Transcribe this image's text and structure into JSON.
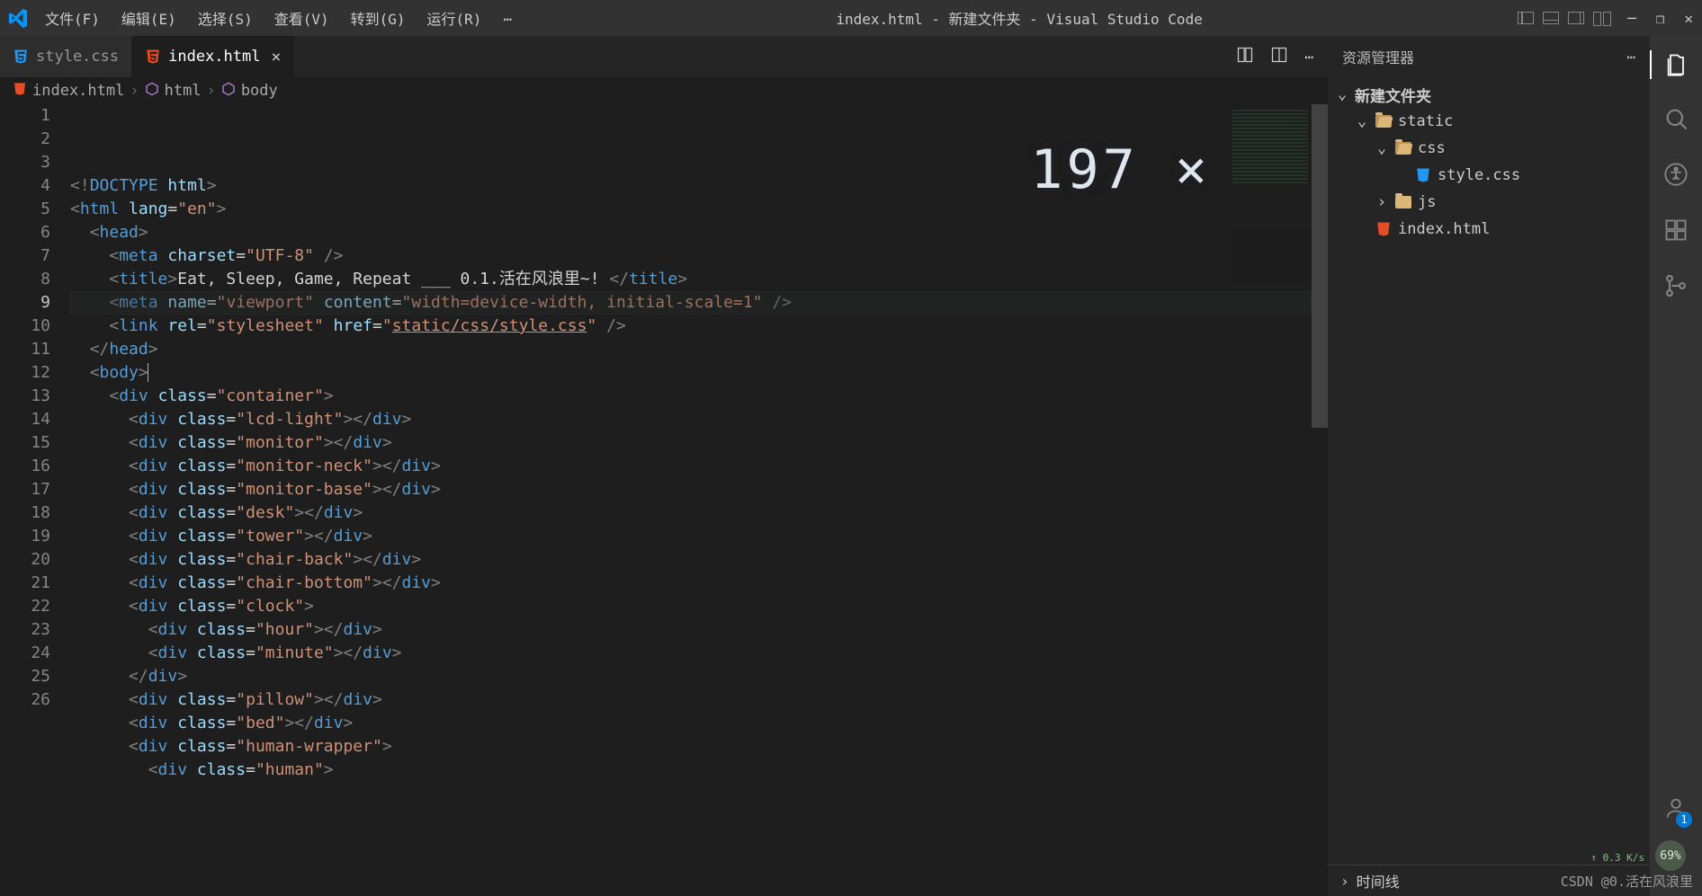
{
  "title": "index.html - 新建文件夹 - Visual Studio Code",
  "menus": [
    "文件(F)",
    "编辑(E)",
    "选择(S)",
    "查看(V)",
    "转到(G)",
    "运行(R)"
  ],
  "menu_more": "…",
  "tabs": [
    {
      "label": "style.css",
      "active": false
    },
    {
      "label": "index.html",
      "active": true
    }
  ],
  "breadcrumb": [
    "index.html",
    "html",
    "body"
  ],
  "overlay_text": "197 ×",
  "explorer": {
    "title": "资源管理器",
    "root": "新建文件夹",
    "tree": [
      {
        "indent": 1,
        "type": "fold-open",
        "label": "static",
        "chev": "v"
      },
      {
        "indent": 2,
        "type": "fold-open",
        "label": "css",
        "chev": "v"
      },
      {
        "indent": 3,
        "type": "css",
        "label": "style.css",
        "chev": ""
      },
      {
        "indent": 2,
        "type": "fold",
        "label": "js",
        "chev": ">"
      },
      {
        "indent": 1,
        "type": "html",
        "label": "index.html",
        "chev": ""
      }
    ],
    "timeline": "时间线"
  },
  "code_lines": [
    {
      "n": 1,
      "html": "<span class='t-bracket'>&lt;!</span><span class='t-tag'>DOCTYPE</span> <span class='t-attr'>html</span><span class='t-bracket'>&gt;</span>"
    },
    {
      "n": 2,
      "html": "<span class='t-bracket'>&lt;</span><span class='t-tag'>html</span> <span class='t-attr'>lang</span>=<span class='t-str'>\"en\"</span><span class='t-bracket'>&gt;</span>"
    },
    {
      "n": 3,
      "html": "  <span class='t-bracket'>&lt;</span><span class='t-tag'>head</span><span class='t-bracket'>&gt;</span>"
    },
    {
      "n": 4,
      "html": "    <span class='t-bracket'>&lt;</span><span class='t-tag'>meta</span> <span class='t-attr'>charset</span>=<span class='t-str'>\"UTF-8\"</span> <span class='t-bracket'>/&gt;</span>"
    },
    {
      "n": 5,
      "html": "    <span class='t-bracket'>&lt;</span><span class='t-tag'>title</span><span class='t-bracket'>&gt;</span>Eat, Sleep, Game, Repeat ___ 0.1.活在风浪里~! <span class='t-bracket'>&lt;/</span><span class='t-tag'>title</span><span class='t-bracket'>&gt;</span>"
    },
    {
      "n": 6,
      "html": "    <span class='t-bracket'>&lt;</span><span class='t-tag'>meta</span> <span class='t-attr'>name</span>=<span class='t-str'>\"viewport\"</span> <span class='t-attr'>content</span>=<span class='t-str'>\"width=device-width, initial-scale=1\"</span> <span class='t-bracket'>/&gt;</span>"
    },
    {
      "n": 7,
      "html": "    <span class='t-bracket'>&lt;</span><span class='t-tag'>link</span> <span class='t-attr'>rel</span>=<span class='t-str'>\"stylesheet\"</span> <span class='t-attr'>href</span>=<span class='t-str'>\"<span class='t-ul'>static/css/style.css</span>\"</span> <span class='t-bracket'>/&gt;</span>"
    },
    {
      "n": 8,
      "html": "  <span class='t-bracket'>&lt;/</span><span class='t-tag'>head</span><span class='t-bracket'>&gt;</span>"
    },
    {
      "n": 9,
      "html": "  <span class='t-bracket'>&lt;</span><span class='t-tag'>body</span><span class='t-bracket'>&gt;</span><span class='cursor'></span>"
    },
    {
      "n": 10,
      "html": "    <span class='t-bracket'>&lt;</span><span class='t-tag'>div</span> <span class='t-attr'>class</span>=<span class='t-str'>\"container\"</span><span class='t-bracket'>&gt;</span>"
    },
    {
      "n": 11,
      "html": "      <span class='t-bracket'>&lt;</span><span class='t-tag'>div</span> <span class='t-attr'>class</span>=<span class='t-str'>\"lcd-light\"</span><span class='t-bracket'>&gt;&lt;/</span><span class='t-tag'>div</span><span class='t-bracket'>&gt;</span>"
    },
    {
      "n": 12,
      "html": "      <span class='t-bracket'>&lt;</span><span class='t-tag'>div</span> <span class='t-attr'>class</span>=<span class='t-str'>\"monitor\"</span><span class='t-bracket'>&gt;&lt;/</span><span class='t-tag'>div</span><span class='t-bracket'>&gt;</span>"
    },
    {
      "n": 13,
      "html": "      <span class='t-bracket'>&lt;</span><span class='t-tag'>div</span> <span class='t-attr'>class</span>=<span class='t-str'>\"monitor-neck\"</span><span class='t-bracket'>&gt;&lt;/</span><span class='t-tag'>div</span><span class='t-bracket'>&gt;</span>"
    },
    {
      "n": 14,
      "html": "      <span class='t-bracket'>&lt;</span><span class='t-tag'>div</span> <span class='t-attr'>class</span>=<span class='t-str'>\"monitor-base\"</span><span class='t-bracket'>&gt;&lt;/</span><span class='t-tag'>div</span><span class='t-bracket'>&gt;</span>"
    },
    {
      "n": 15,
      "html": "      <span class='t-bracket'>&lt;</span><span class='t-tag'>div</span> <span class='t-attr'>class</span>=<span class='t-str'>\"desk\"</span><span class='t-bracket'>&gt;&lt;/</span><span class='t-tag'>div</span><span class='t-bracket'>&gt;</span>"
    },
    {
      "n": 16,
      "html": "      <span class='t-bracket'>&lt;</span><span class='t-tag'>div</span> <span class='t-attr'>class</span>=<span class='t-str'>\"tower\"</span><span class='t-bracket'>&gt;&lt;/</span><span class='t-tag'>div</span><span class='t-bracket'>&gt;</span>"
    },
    {
      "n": 17,
      "html": "      <span class='t-bracket'>&lt;</span><span class='t-tag'>div</span> <span class='t-attr'>class</span>=<span class='t-str'>\"chair-back\"</span><span class='t-bracket'>&gt;&lt;/</span><span class='t-tag'>div</span><span class='t-bracket'>&gt;</span>"
    },
    {
      "n": 18,
      "html": "      <span class='t-bracket'>&lt;</span><span class='t-tag'>div</span> <span class='t-attr'>class</span>=<span class='t-str'>\"chair-bottom\"</span><span class='t-bracket'>&gt;&lt;/</span><span class='t-tag'>div</span><span class='t-bracket'>&gt;</span>"
    },
    {
      "n": 19,
      "html": "      <span class='t-bracket'>&lt;</span><span class='t-tag'>div</span> <span class='t-attr'>class</span>=<span class='t-str'>\"clock\"</span><span class='t-bracket'>&gt;</span>"
    },
    {
      "n": 20,
      "html": "        <span class='t-bracket'>&lt;</span><span class='t-tag'>div</span> <span class='t-attr'>class</span>=<span class='t-str'>\"hour\"</span><span class='t-bracket'>&gt;&lt;/</span><span class='t-tag'>div</span><span class='t-bracket'>&gt;</span>"
    },
    {
      "n": 21,
      "html": "        <span class='t-bracket'>&lt;</span><span class='t-tag'>div</span> <span class='t-attr'>class</span>=<span class='t-str'>\"minute\"</span><span class='t-bracket'>&gt;&lt;/</span><span class='t-tag'>div</span><span class='t-bracket'>&gt;</span>"
    },
    {
      "n": 22,
      "html": "      <span class='t-bracket'>&lt;/</span><span class='t-tag'>div</span><span class='t-bracket'>&gt;</span>"
    },
    {
      "n": 23,
      "html": "      <span class='t-bracket'>&lt;</span><span class='t-tag'>div</span> <span class='t-attr'>class</span>=<span class='t-str'>\"pillow\"</span><span class='t-bracket'>&gt;&lt;/</span><span class='t-tag'>div</span><span class='t-bracket'>&gt;</span>"
    },
    {
      "n": 24,
      "html": "      <span class='t-bracket'>&lt;</span><span class='t-tag'>div</span> <span class='t-attr'>class</span>=<span class='t-str'>\"bed\"</span><span class='t-bracket'>&gt;&lt;/</span><span class='t-tag'>div</span><span class='t-bracket'>&gt;</span>"
    },
    {
      "n": 25,
      "html": "      <span class='t-bracket'>&lt;</span><span class='t-tag'>div</span> <span class='t-attr'>class</span>=<span class='t-str'>\"human-wrapper\"</span><span class='t-bracket'>&gt;</span>"
    },
    {
      "n": 26,
      "html": "        <span class='t-bracket'>&lt;</span><span class='t-tag'>div</span> <span class='t-attr'>class</span>=<span class='t-str'>\"human\"</span><span class='t-bracket'>&gt;</span>"
    }
  ],
  "watermark": "CSDN @0.活在风浪里",
  "netspeed": "↑ 0.3 K/s",
  "badge69": "69%",
  "account_badge": "1"
}
